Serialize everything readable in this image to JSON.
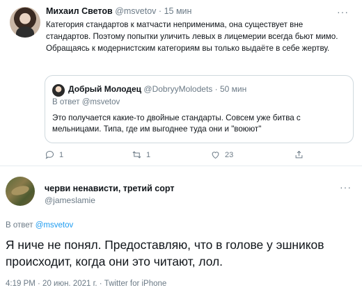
{
  "tweet": {
    "author_name": "Михаил Светов",
    "author_handle": "@msvetov",
    "separator": "·",
    "time": "15 мин",
    "text": "Категория стандартов к матчасти неприменима, она существует вне стандартов. Поэтому попытки уличить левых в лицемерии всегда бьют мимо. Обращаясь к модернистским категориям вы только выдаёте в себе жертву.",
    "more_icon": "···",
    "quoted": {
      "author_name": "Добрый Молодец",
      "author_handle": "@DobryyMolodets",
      "separator": "·",
      "time": "50 мин",
      "reply_to": "В ответ @msvetov",
      "text": "Это получается какие-то двойные стандарты. Совсем уже битва с мельницами.  Типа, где им выгоднее туда они и \"воюют\""
    },
    "actions": {
      "reply_count": "1",
      "retweet_count": "1",
      "like_count": "23",
      "icons": [
        "reply-icon",
        "retweet-icon",
        "like-icon",
        "share-icon"
      ]
    }
  },
  "reply_tweet": {
    "author_name": "черви ненависти, третий сорт",
    "author_handle": "@jameslamie",
    "more_icon": "···",
    "reply_prefix": "В ответ",
    "reply_to_handle": "@msvetov",
    "text": "Я ниче не понял. Предоставляю, что в голове у эшников происходит, когда они это читают, лол.",
    "meta": "4:19 PM · 20 июн. 2021 г. · Twitter for iPhone"
  },
  "colors": {
    "text": "#0f1419",
    "muted": "#6b7a86",
    "link": "#1d9bf0",
    "border": "#cfd9de"
  }
}
